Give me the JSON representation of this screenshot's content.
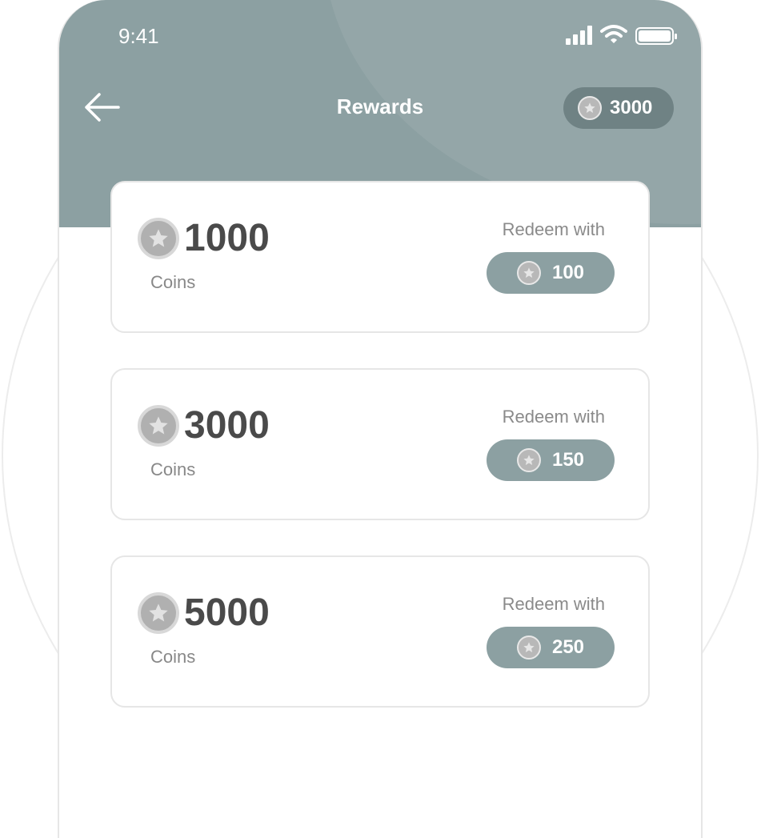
{
  "status_bar": {
    "time": "9:41"
  },
  "header": {
    "title": "Rewards",
    "balance": "3000"
  },
  "rewards": [
    {
      "amount": "1000",
      "unit": "Coins",
      "redeem_label": "Redeem with",
      "cost": "100"
    },
    {
      "amount": "3000",
      "unit": "Coins",
      "redeem_label": "Redeem with",
      "cost": "150"
    },
    {
      "amount": "5000",
      "unit": "Coins",
      "redeem_label": "Redeem with",
      "cost": "250"
    }
  ],
  "colors": {
    "header": "#8ca0a2",
    "pill": "#6f8284",
    "button": "#8ca0a2",
    "text_dark": "#4a4a4a"
  },
  "icons": {
    "back": "arrow-left-icon",
    "coin": "star-coin-icon",
    "signal": "cellular-signal-icon",
    "wifi": "wifi-icon",
    "battery": "battery-icon"
  }
}
